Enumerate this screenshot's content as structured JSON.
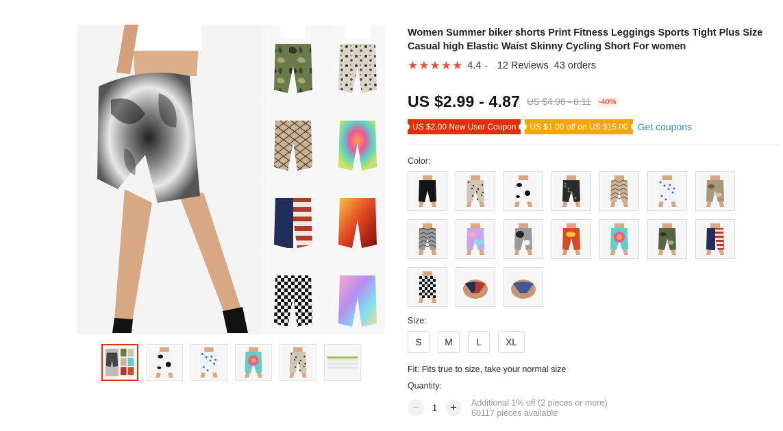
{
  "product": {
    "title": "Women Summer biker shorts Print Fitness Leggings Sports Tight Plus Size Casual high Elastic Waist Skinny Cycling Short For women",
    "rating": "4.4",
    "rating_caret": "⌄",
    "reviews": "12 Reviews",
    "orders": "43 orders",
    "star_icon": "★"
  },
  "price": {
    "current": "US $2.99 - 4.87",
    "original": "US $4.98 - 8.11",
    "discount": "-40%"
  },
  "coupons": {
    "new_user": "US $2.00 New User Coupon",
    "store": "US $1.00 off on US $15.00",
    "get_link": "Get coupons"
  },
  "color": {
    "label": "Color:",
    "options": [
      {
        "name": "black",
        "pattern": "black"
      },
      {
        "name": "leopard",
        "pattern": "leopard"
      },
      {
        "name": "cow print",
        "pattern": "cow"
      },
      {
        "name": "dark floral",
        "pattern": "darkfloral"
      },
      {
        "name": "snake print",
        "pattern": "snake"
      },
      {
        "name": "blue floral",
        "pattern": "bluefloral"
      },
      {
        "name": "tan camo",
        "pattern": "tancamo"
      },
      {
        "name": "grey snake",
        "pattern": "greysnake"
      },
      {
        "name": "pastel tie-dye",
        "pattern": "pastel"
      },
      {
        "name": "black white tie-dye",
        "pattern": "tiedye"
      },
      {
        "name": "red fire",
        "pattern": "fire"
      },
      {
        "name": "rainbow swirl",
        "pattern": "swirl"
      },
      {
        "name": "green camo",
        "pattern": "camo"
      },
      {
        "name": "flag",
        "pattern": "flag"
      },
      {
        "name": "checkered",
        "pattern": "checker"
      },
      {
        "name": "bikini flag",
        "pattern": "bikiniflag"
      },
      {
        "name": "bikini blue",
        "pattern": "bikiniblue"
      }
    ]
  },
  "size": {
    "label": "Size:",
    "options": [
      "S",
      "M",
      "L",
      "XL"
    ]
  },
  "fit": "Fit: Fits true to size, take your normal size",
  "quantity": {
    "label": "Quantity:",
    "value": "1",
    "minus": "−",
    "plus": "+",
    "note": "Additional 1% off (2 pieces or more)",
    "available": "60117 pieces available"
  },
  "gallery": {
    "thumbnails": [
      "collage",
      "cow",
      "bluefloral",
      "swirl",
      "leopard",
      "sizechart"
    ],
    "active_index": 0
  },
  "colors": {
    "accent_red": "#e62e04",
    "coupon_orange": "#f9a400",
    "link_blue": "#2b8eb5",
    "star": "#e94f3c"
  }
}
